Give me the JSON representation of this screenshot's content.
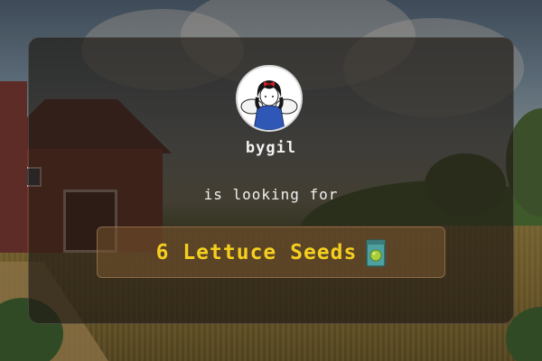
{
  "request": {
    "username": "bygil",
    "subtitle": "is looking for",
    "quantity": "6",
    "item_name": "Lettuce Seeds",
    "item_text": "6 Lettuce Seeds",
    "item_icon": "seed-packet-icon"
  },
  "colors": {
    "accent_text": "#f5cf1f",
    "card_overlay": "#201a14",
    "request_box": "#78562f"
  }
}
